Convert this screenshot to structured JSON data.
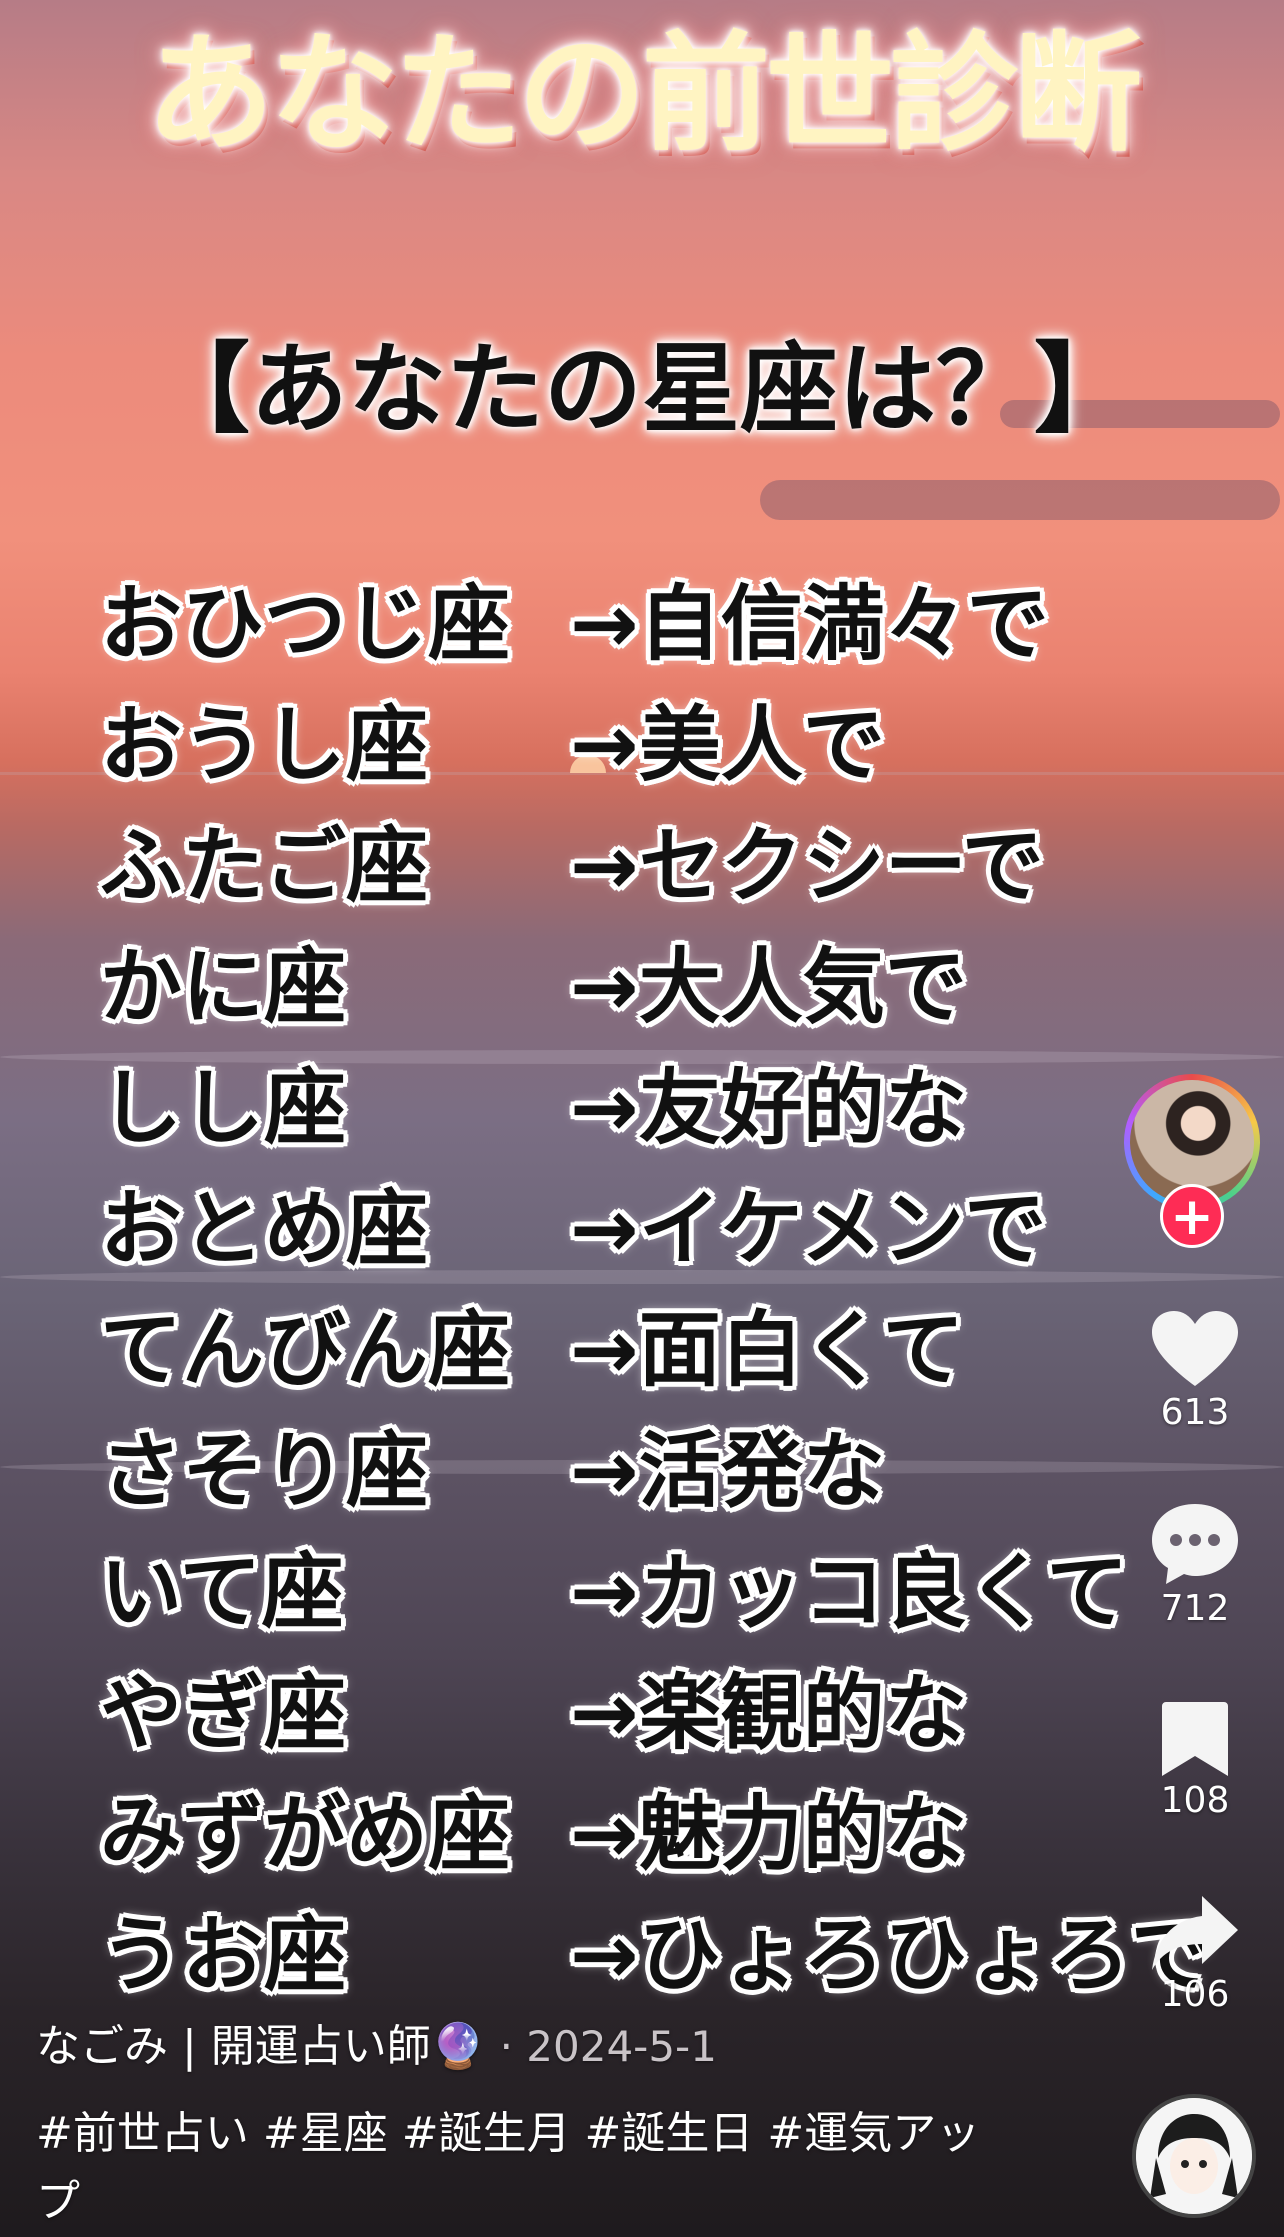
{
  "video": {
    "title": "あなたの前世診断",
    "subtitle": "【あなたの星座は？】",
    "rows": [
      {
        "sign": "おひつじ座",
        "trait": "→自信満々で"
      },
      {
        "sign": "おうし座",
        "trait": "→美人で"
      },
      {
        "sign": "ふたご座",
        "trait": "→セクシーで"
      },
      {
        "sign": "かに座",
        "trait": "→大人気で"
      },
      {
        "sign": "しし座",
        "trait": "→友好的な"
      },
      {
        "sign": "おとめ座",
        "trait": "→イケメンで"
      },
      {
        "sign": "てんびん座",
        "trait": "→面白くて"
      },
      {
        "sign": "さそり座",
        "trait": "→活発な"
      },
      {
        "sign": "いて座",
        "trait": "→カッコ良くて"
      },
      {
        "sign": "やぎ座",
        "trait": "→楽観的な"
      },
      {
        "sign": "みずがめ座",
        "trait": "→魅力的な"
      },
      {
        "sign": "うお座",
        "trait": "→ひょろひょろで"
      }
    ]
  },
  "rail": {
    "follow_symbol": "+",
    "likes": "613",
    "comments": "712",
    "saves": "108",
    "shares": "106"
  },
  "caption": {
    "author": "なごみ | 開運占い師🔮",
    "date": "· 2024-5-1",
    "hashtags": "#前世占い #星座 #誕生月 #誕生日 #運気アップ"
  },
  "icons": {
    "like": "heart-icon",
    "comment": "comment-bubble-icon",
    "save": "bookmark-icon",
    "share": "share-arrow-icon"
  }
}
